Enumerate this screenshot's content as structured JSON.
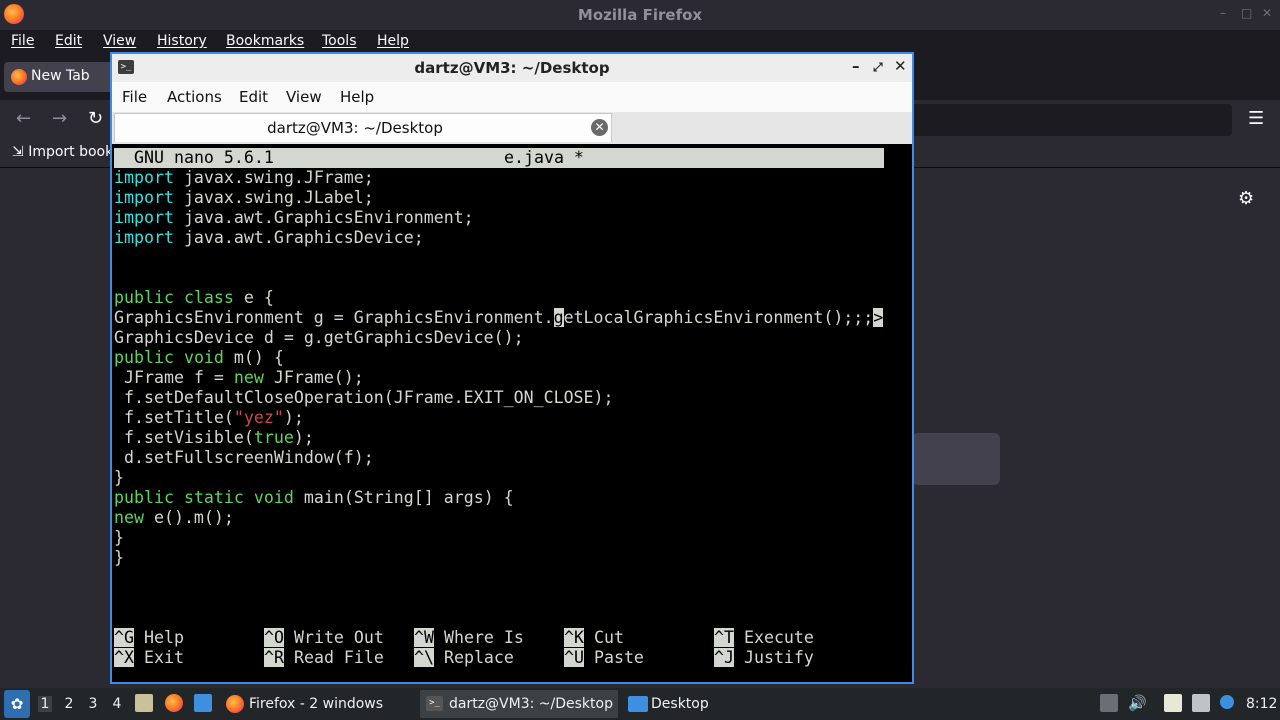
{
  "firefox": {
    "window_title": "Mozilla Firefox",
    "menu": [
      "File",
      "Edit",
      "View",
      "History",
      "Bookmarks",
      "Tools",
      "Help"
    ],
    "tab_label": "New Tab",
    "bookmark_label": "Import book"
  },
  "terminal": {
    "window_title": "dartz@VM3: ~/Desktop",
    "menu": [
      "File",
      "Actions",
      "Edit",
      "View",
      "Help"
    ],
    "tab_label": "dartz@VM3: ~/Desktop"
  },
  "nano": {
    "app": "GNU nano 5.6.1",
    "filename": "e.java *",
    "lines": [
      [
        {
          "t": "import",
          "c": "kw"
        },
        {
          "t": " javax.swing.JFrame;"
        }
      ],
      [
        {
          "t": "import",
          "c": "kw"
        },
        {
          "t": " javax.swing.JLabel;"
        }
      ],
      [
        {
          "t": "import",
          "c": "kw"
        },
        {
          "t": " java.awt.GraphicsEnvironment;"
        }
      ],
      [
        {
          "t": "import",
          "c": "kw"
        },
        {
          "t": " java.awt.GraphicsDevice;"
        }
      ],
      [],
      [],
      [
        {
          "t": "public",
          "c": "kg"
        },
        {
          "t": " "
        },
        {
          "t": "class",
          "c": "kg"
        },
        {
          "t": " e {"
        }
      ],
      [
        {
          "t": "GraphicsEnvironment g = GraphicsEnvironment."
        },
        {
          "t": "g",
          "c": "cursor"
        },
        {
          "t": "etLocalGraphicsEnvironment();;;"
        },
        {
          "t": ">",
          "c": "trunc"
        }
      ],
      [
        {
          "t": "GraphicsDevice d = g.getGraphicsDevice();"
        }
      ],
      [
        {
          "t": "public",
          "c": "kg"
        },
        {
          "t": " "
        },
        {
          "t": "void",
          "c": "kg"
        },
        {
          "t": " m() {"
        }
      ],
      [
        {
          "t": " JFrame f = "
        },
        {
          "t": "new",
          "c": "kg"
        },
        {
          "t": " JFrame();"
        }
      ],
      [
        {
          "t": " f.setDefaultCloseOperation(JFrame.EXIT_ON_CLOSE);"
        }
      ],
      [
        {
          "t": " f.setTitle("
        },
        {
          "t": "\"yez\"",
          "c": "str"
        },
        {
          "t": ");"
        }
      ],
      [
        {
          "t": " f.setVisible("
        },
        {
          "t": "true",
          "c": "kg"
        },
        {
          "t": ");"
        }
      ],
      [
        {
          "t": " d.setFullscreenWindow(f);"
        }
      ],
      [
        {
          "t": "}"
        }
      ],
      [
        {
          "t": "public",
          "c": "kg"
        },
        {
          "t": " "
        },
        {
          "t": "static",
          "c": "kg"
        },
        {
          "t": " "
        },
        {
          "t": "void",
          "c": "kg"
        },
        {
          "t": " main(String[] args) {"
        }
      ],
      [
        {
          "t": "new",
          "c": "kg"
        },
        {
          "t": " e().m();"
        }
      ],
      [
        {
          "t": "}"
        }
      ],
      [
        {
          "t": "}"
        }
      ]
    ],
    "shortcuts_row1": [
      {
        "key": "^G",
        "label": "Help"
      },
      {
        "key": "^O",
        "label": "Write Out"
      },
      {
        "key": "^W",
        "label": "Where Is"
      },
      {
        "key": "^K",
        "label": "Cut"
      },
      {
        "key": "^T",
        "label": "Execute"
      }
    ],
    "shortcuts_row2": [
      {
        "key": "^X",
        "label": "Exit"
      },
      {
        "key": "^R",
        "label": "Read File"
      },
      {
        "key": "^\\",
        "label": "Replace"
      },
      {
        "key": "^U",
        "label": "Paste"
      },
      {
        "key": "^J",
        "label": "Justify"
      }
    ]
  },
  "taskbar": {
    "workspaces": [
      "1",
      "2",
      "3",
      "4"
    ],
    "tasks": [
      "Firefox - 2 windows",
      "dartz@VM3: ~/Desktop",
      "Desktop"
    ],
    "clock": "8:12"
  }
}
